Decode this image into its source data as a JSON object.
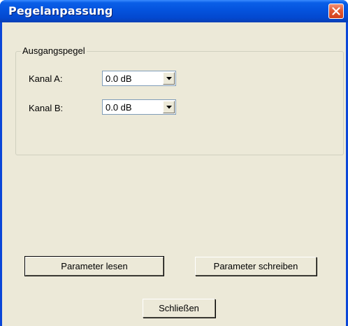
{
  "window": {
    "title": "Pegelanpassung"
  },
  "output_group": {
    "label": "Ausgangspegel",
    "channel_a": {
      "label": "Kanal A:",
      "value": "0.0 dB"
    },
    "channel_b": {
      "label": "Kanal B:",
      "value": "0.0 dB"
    }
  },
  "buttons": {
    "read": "Parameter lesen",
    "write": "Parameter schreiben",
    "close": "Schließen"
  },
  "colors": {
    "titlebar": "#0453dd",
    "client": "#ece9d8",
    "close_button": "#e25a34"
  }
}
